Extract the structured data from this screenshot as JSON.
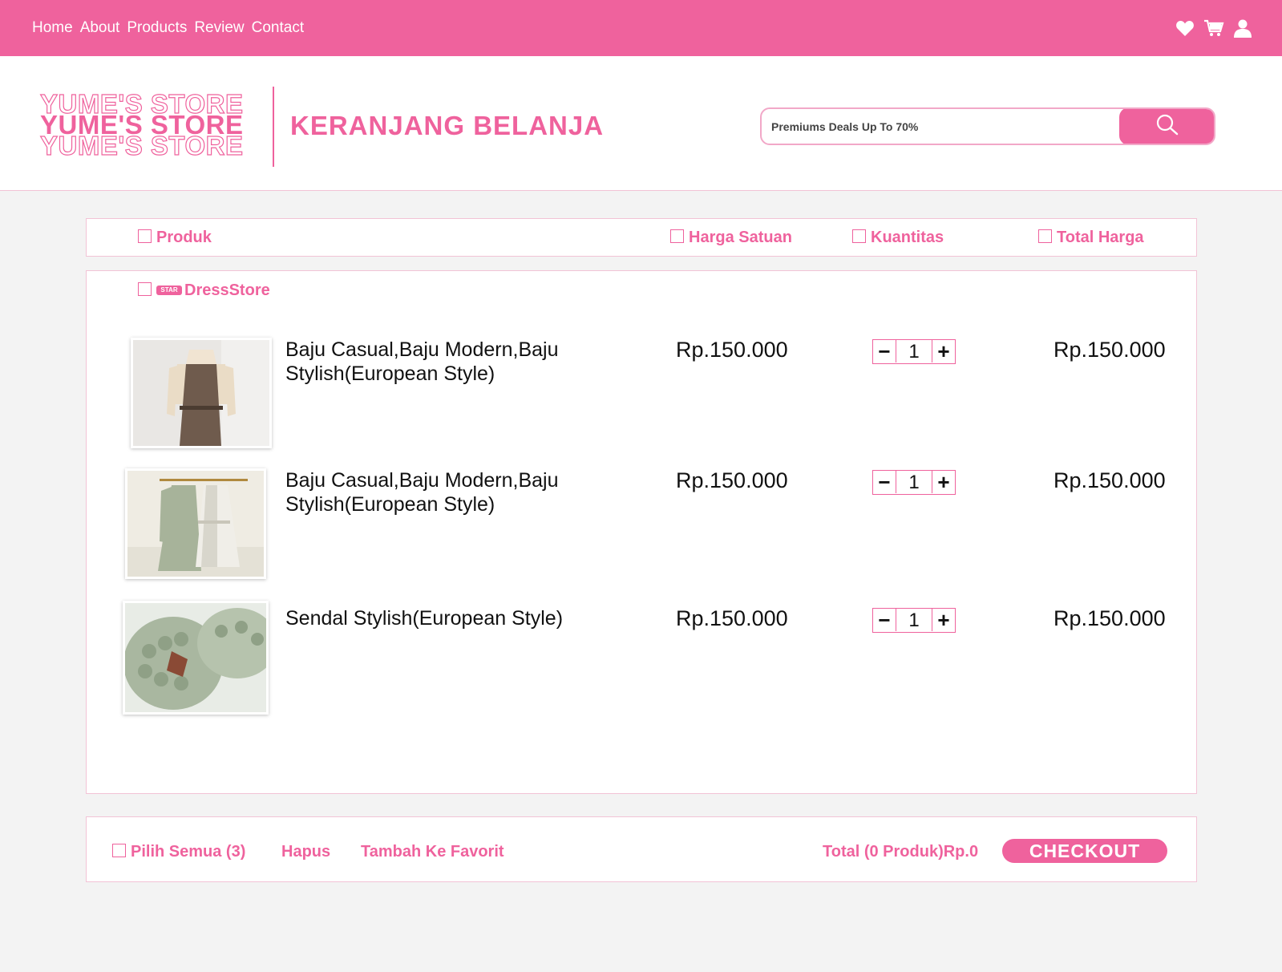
{
  "nav": {
    "links": [
      "Home",
      "About",
      "Products",
      "Review",
      "Contact"
    ],
    "icons": [
      "heart-icon",
      "cart-icon",
      "user-icon"
    ]
  },
  "header": {
    "logo_lines": [
      "YUME'S STORE",
      "YUME'S STORE",
      "YUME'S STORE"
    ],
    "title": "KERANJANG BELANJA",
    "search_placeholder": "Premiums Deals Up To 70%"
  },
  "table_header": {
    "product": "Produk",
    "unit_price": "Harga Satuan",
    "quantity": "Kuantitas",
    "total_price": "Total Harga"
  },
  "store": {
    "badge": "STAR",
    "name": "DressStore"
  },
  "items": [
    {
      "name": "Baju Casual,Baju Modern,Baju Stylish(European Style)",
      "price": "Rp.150.000",
      "qty": "1",
      "total": "Rp.150.000"
    },
    {
      "name": "Baju Casual,Baju Modern,Baju Stylish(European Style)",
      "price": "Rp.150.000",
      "qty": "1",
      "total": "Rp.150.000"
    },
    {
      "name": "Sendal Stylish(European Style)",
      "price": "Rp.150.000",
      "qty": "1",
      "total": "Rp.150.000"
    }
  ],
  "footer": {
    "select_all": "Pilih Semua (3)",
    "delete": "Hapus",
    "add_favorite": "Tambah Ke Favorit",
    "total": "Total (0 Produk)Rp.0",
    "checkout": "CHECKOUT"
  },
  "colors": {
    "accent": "#ef629d",
    "border": "#f2c3d6",
    "background": "#f3f3f3"
  }
}
